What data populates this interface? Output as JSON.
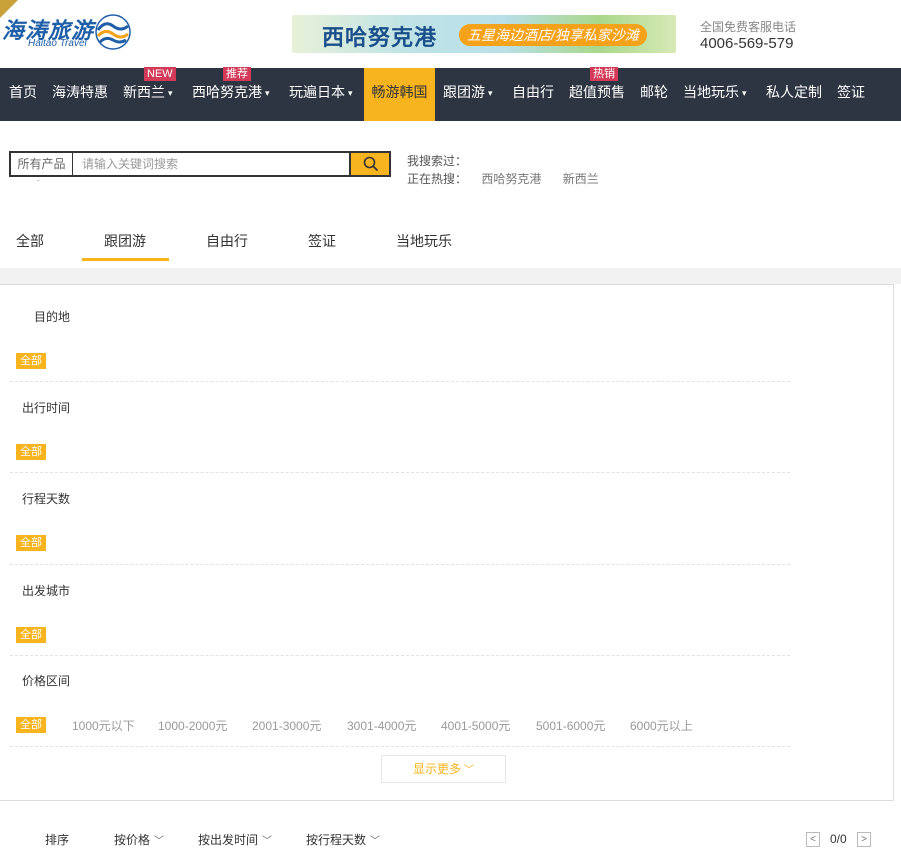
{
  "header": {
    "logo_text": "海涛旅游",
    "logo_en": "Haitao Travel",
    "banner_title": "西哈努克港",
    "banner_slogan": "五星海边酒店/独享私家沙滩",
    "hotline_label": "全国免费客服电话",
    "hotline_number": "4006-569-579"
  },
  "nav": {
    "items": [
      {
        "label": "首页"
      },
      {
        "label": "海涛特惠"
      },
      {
        "label": "新西兰",
        "badge": "NEW"
      },
      {
        "label": "西哈努克港",
        "badge": "推荐"
      },
      {
        "label": "玩遍日本"
      },
      {
        "label": "畅游韩国"
      },
      {
        "label": "跟团游"
      },
      {
        "label": "自由行"
      },
      {
        "label": "超值预售",
        "badge": "热销"
      },
      {
        "label": "邮轮"
      },
      {
        "label": "当地玩乐"
      },
      {
        "label": "私人定制"
      },
      {
        "label": "签证"
      }
    ],
    "caret": "▾",
    "active_color": "#f7b41e",
    "bg_color": "#2c3541",
    "badge_color": "#d23a58"
  },
  "search": {
    "category": "所有产品",
    "placeholder": "请输入关键词搜索",
    "value": "",
    "icon": "search-icon",
    "recent_label": "我搜索过：",
    "hot_label": "正在热搜：",
    "hot_keywords": [
      "西哈努克港",
      "新西兰"
    ]
  },
  "tabs": {
    "items": [
      "全部",
      "跟团游",
      "自由行",
      "签证",
      "当地玩乐"
    ],
    "active_index": 1
  },
  "filters": {
    "all_label": "全部",
    "rows": [
      {
        "title": "目的地"
      },
      {
        "title": "出行时间"
      },
      {
        "title": "行程天数"
      },
      {
        "title": "出发城市"
      },
      {
        "title": "价格区间"
      }
    ],
    "price_options": [
      "1000元以下",
      "1000-2000元",
      "2001-3000元",
      "3001-4000元",
      "4001-5000元",
      "5001-6000元",
      "6000元以上"
    ],
    "more_label": "显示更多",
    "more_icon": "chevron-down-icon"
  },
  "sortbar": {
    "label": "排序",
    "options": [
      "按价格",
      "按出发时间",
      "按行程天数"
    ],
    "page_text": "0/0",
    "prev_icon": "chevron-left-icon",
    "next_icon": "chevron-right-icon"
  }
}
